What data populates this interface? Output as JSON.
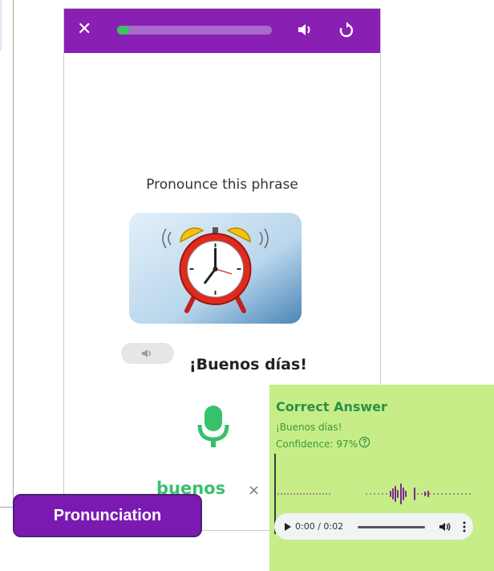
{
  "colors": {
    "topbar": "#8a1fb4",
    "progress_fill": "#3ac45d",
    "correct_panel": "#c6ed88",
    "correct_text": "#2c8f47",
    "transcript_word": "#3bbf6d",
    "label_tag": "#7a1ab0"
  },
  "topbar": {
    "close_icon": "close-icon",
    "progress_value": 0.08,
    "speaker_icon": "speaker-icon",
    "restart_icon": "restart-icon"
  },
  "lesson": {
    "prompt": "Pronounce this phrase",
    "image_icon": "alarm-clock-illustration",
    "phrase": "¡Buenos días!",
    "transcript_word": "buenos",
    "transcript_clear": "×"
  },
  "answer": {
    "title": "Correct Answer",
    "text": "¡Buenos días!",
    "confidence": "Confidence: 97%",
    "audio_time": "0:00 / 0:02"
  },
  "label": "Pronunciation"
}
